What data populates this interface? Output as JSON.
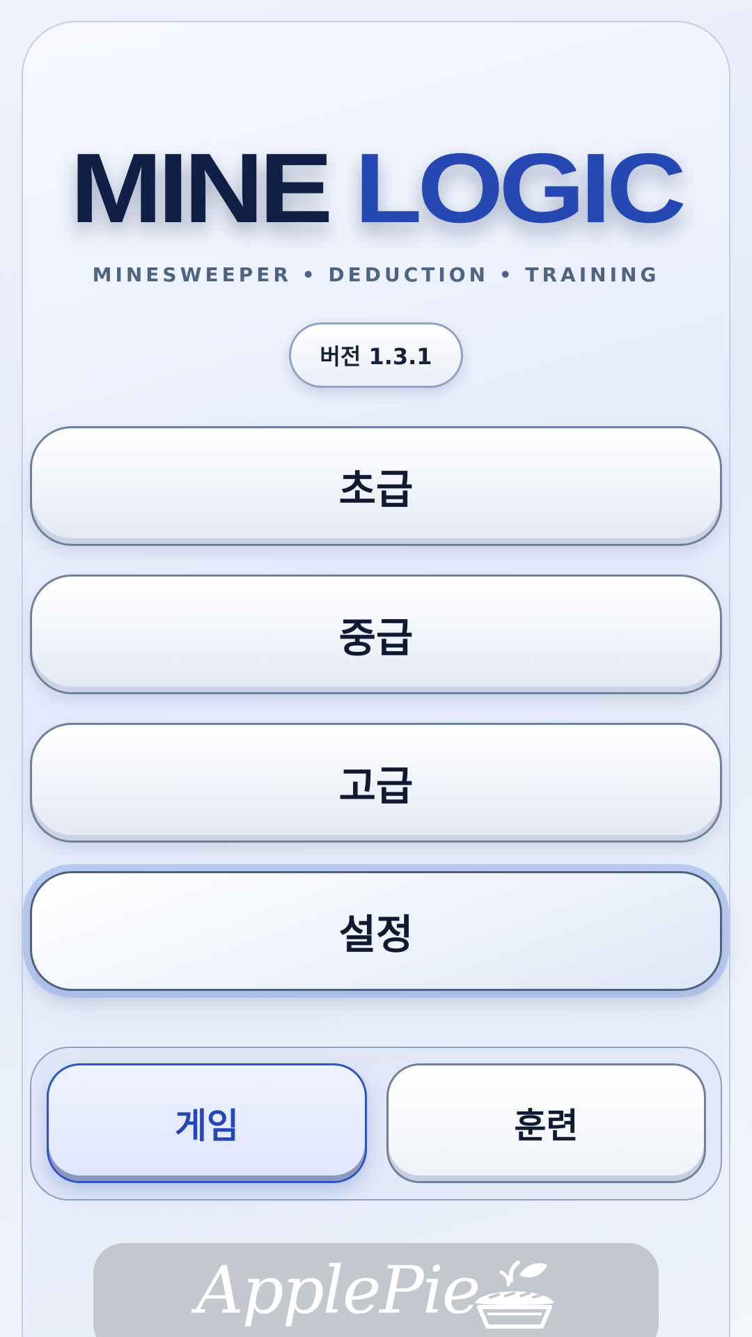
{
  "app": {
    "title_part1": "MINE",
    "title_part2": "LOGIC",
    "subtitle": "MINESWEEPER • DEDUCTION • TRAINING",
    "version": "버전 1.3.1"
  },
  "menu": {
    "beginner": "초급",
    "intermediate": "중급",
    "advanced": "고급",
    "settings": "설정"
  },
  "modes": {
    "game": "게임",
    "training": "훈련",
    "selected": "게임"
  },
  "banner": {
    "logo_text": "ApplePie",
    "icon": "apple-pie-icon"
  },
  "colors": {
    "accent": "#2648b3",
    "title_dark": "#0f1f45",
    "subtitle": "#4f6482",
    "banner_bg": "#c3c7ce"
  }
}
